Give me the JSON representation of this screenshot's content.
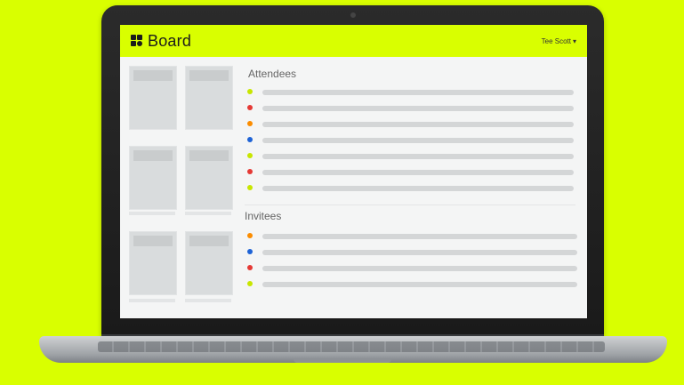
{
  "app": {
    "brand": "Board",
    "user_menu": "Tee Scott",
    "caret": "▾"
  },
  "attendees": {
    "title": "Attendees",
    "rows": [
      {
        "color": "#c8e600"
      },
      {
        "color": "#e53935"
      },
      {
        "color": "#fb8c00"
      },
      {
        "color": "#1e63d6"
      },
      {
        "color": "#c8e600"
      },
      {
        "color": "#e53935"
      },
      {
        "color": "#c8e600"
      }
    ]
  },
  "invitees": {
    "title": "Invitees",
    "rows": [
      {
        "color": "#fb8c00"
      },
      {
        "color": "#1e63d6"
      },
      {
        "color": "#e53935"
      },
      {
        "color": "#c8e600"
      }
    ]
  },
  "icons": {
    "logo": "board-logo-icon",
    "user_menu_caret": "chevron-down-icon"
  },
  "colors": {
    "accent": "#d9ff00",
    "background": "#d9ff00"
  }
}
